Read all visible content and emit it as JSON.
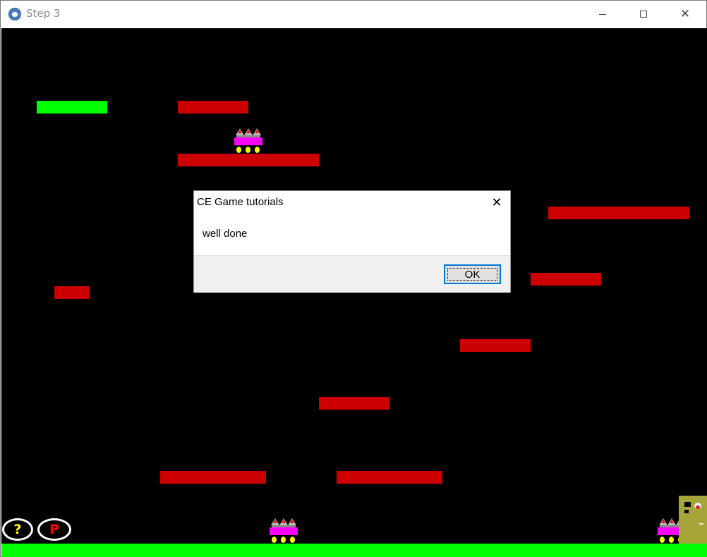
{
  "window": {
    "title": "Step 3"
  },
  "titlebar": {
    "minimize_icon": "minimize-icon",
    "maximize_icon": "maximize-icon",
    "close_icon": "close-icon"
  },
  "colors": {
    "platform": "#cc0000",
    "goal_platform": "#00ff00",
    "ground": "#00ff00",
    "enemy_body": "#ff00ff",
    "enemy_wheels": "#ffff00",
    "door": "#a6a53a"
  },
  "hud": {
    "help_label": "?",
    "pause_label": "P",
    "help_color": "#ffff00",
    "pause_color": "#ff0000"
  },
  "dialog": {
    "title": "CE Game tutorials",
    "message": "well done",
    "ok_label": "OK",
    "close_glyph": "✕"
  }
}
